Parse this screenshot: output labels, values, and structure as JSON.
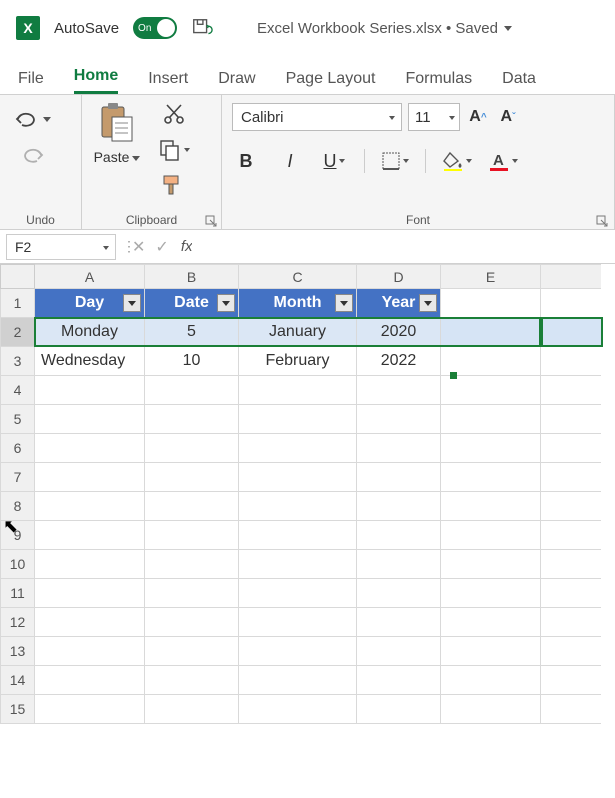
{
  "titlebar": {
    "autosave_label": "AutoSave",
    "toggle_state": "On",
    "document": "Excel Workbook Series.xlsx • Saved"
  },
  "tabs": [
    "File",
    "Home",
    "Insert",
    "Draw",
    "Page Layout",
    "Formulas",
    "Data"
  ],
  "active_tab": "Home",
  "ribbon": {
    "undo_label": "Undo",
    "clipboard_label": "Clipboard",
    "paste_label": "Paste",
    "font_label": "Font",
    "font_name": "Calibri",
    "font_size": "11",
    "bold": "B",
    "italic": "I",
    "underline": "U"
  },
  "namebox": "F2",
  "chart_data": {
    "type": "table",
    "columns": [
      "A",
      "B",
      "C",
      "D",
      "E"
    ],
    "header_row": 1,
    "headers": [
      "Day",
      "Date",
      "Month",
      "Year"
    ],
    "rows": [
      {
        "Day": "Monday",
        "Date": 5,
        "Month": "January",
        "Year": 2020
      },
      {
        "Day": "Wednesday",
        "Date": 10,
        "Month": "February",
        "Year": 2022
      }
    ],
    "selected_row": 2,
    "active_cell": "F2",
    "row_count_visible": 15
  },
  "sheet": {
    "cols": [
      "A",
      "B",
      "C",
      "D",
      "E"
    ],
    "headers": {
      "A": "Day",
      "B": "Date",
      "C": "Month",
      "D": "Year"
    },
    "r2": {
      "A": "Monday",
      "B": "5",
      "C": "January",
      "D": "2020"
    },
    "r3": {
      "A": "Wednesday",
      "B": "10",
      "C": "February",
      "D": "2022"
    }
  }
}
